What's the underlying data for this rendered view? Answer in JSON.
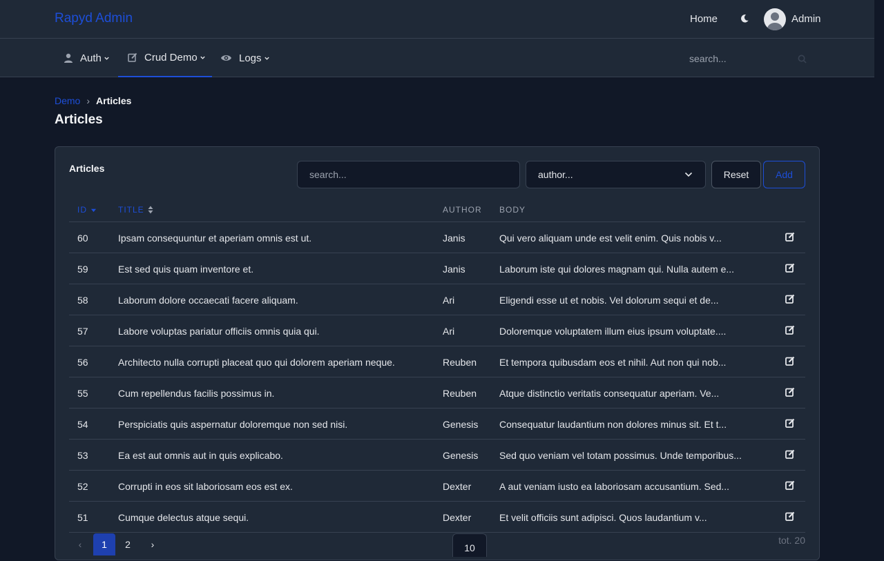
{
  "header": {
    "brand": "Rapyd Admin",
    "home_label": "Home",
    "theme_icon": "moon-icon",
    "user_label": "Admin",
    "avatar_icon": "user-avatar-icon"
  },
  "nav": {
    "items": [
      {
        "label": "Auth",
        "icon": "user-icon"
      },
      {
        "label": "Crud Demo",
        "icon": "edit-icon",
        "active": true
      },
      {
        "label": "Logs",
        "icon": "eye-icon"
      }
    ],
    "search_placeholder": "search..."
  },
  "breadcrumb": {
    "parent": "Demo",
    "separator": "›",
    "current": "Articles"
  },
  "page": {
    "title": "Articles"
  },
  "card": {
    "title": "Articles",
    "search_placeholder": "search...",
    "author_placeholder": "author...",
    "reset_label": "Reset",
    "add_label": "Add"
  },
  "table": {
    "columns": [
      "ID",
      "TITLE",
      "AUTHOR",
      "BODY"
    ],
    "sorted_column": "ID",
    "rows": [
      {
        "id": "60",
        "title": "Ipsam consequuntur et aperiam omnis est ut.",
        "author": "Janis",
        "body": "Qui vero aliquam unde est velit enim. Quis nobis v..."
      },
      {
        "id": "59",
        "title": "Est sed quis quam inventore et.",
        "author": "Janis",
        "body": "Laborum iste qui dolores magnam qui. Nulla autem e..."
      },
      {
        "id": "58",
        "title": "Laborum dolore occaecati facere aliquam.",
        "author": "Ari",
        "body": "Eligendi esse ut et nobis. Vel dolorum sequi et de..."
      },
      {
        "id": "57",
        "title": "Labore voluptas pariatur officiis omnis quia qui.",
        "author": "Ari",
        "body": "Doloremque voluptatem illum eius ipsum voluptate...."
      },
      {
        "id": "56",
        "title": "Architecto nulla corrupti placeat quo qui dolorem aperiam neque.",
        "author": "Reuben",
        "body": "Et tempora quibusdam eos et nihil. Aut non qui nob..."
      },
      {
        "id": "55",
        "title": "Cum repellendus facilis possimus in.",
        "author": "Reuben",
        "body": "Atque distinctio veritatis consequatur aperiam. Ve..."
      },
      {
        "id": "54",
        "title": "Perspiciatis quis aspernatur doloremque non sed nisi.",
        "author": "Genesis",
        "body": "Consequatur laudantium non dolores minus sit. Et t..."
      },
      {
        "id": "53",
        "title": "Ea est aut omnis aut in quis explicabo.",
        "author": "Genesis",
        "body": "Sed quo veniam vel totam possimus. Unde temporibus..."
      },
      {
        "id": "52",
        "title": "Corrupti in eos sit laboriosam eos est ex.",
        "author": "Dexter",
        "body": "A aut veniam iusto ea laboriosam accusantium. Sed..."
      },
      {
        "id": "51",
        "title": "Cumque delectus atque sequi.",
        "author": "Dexter",
        "body": "Et velit officiis sunt adipisci. Quos laudantium v..."
      }
    ]
  },
  "pagination": {
    "prev": "‹",
    "pages": [
      "1",
      "2"
    ],
    "current_page": "1",
    "next": "›",
    "per_page": "10",
    "total": "tot. 20"
  },
  "colors": {
    "accent": "#1d4ed8",
    "background": "#111827",
    "surface": "#1f2937",
    "border": "#374151"
  }
}
